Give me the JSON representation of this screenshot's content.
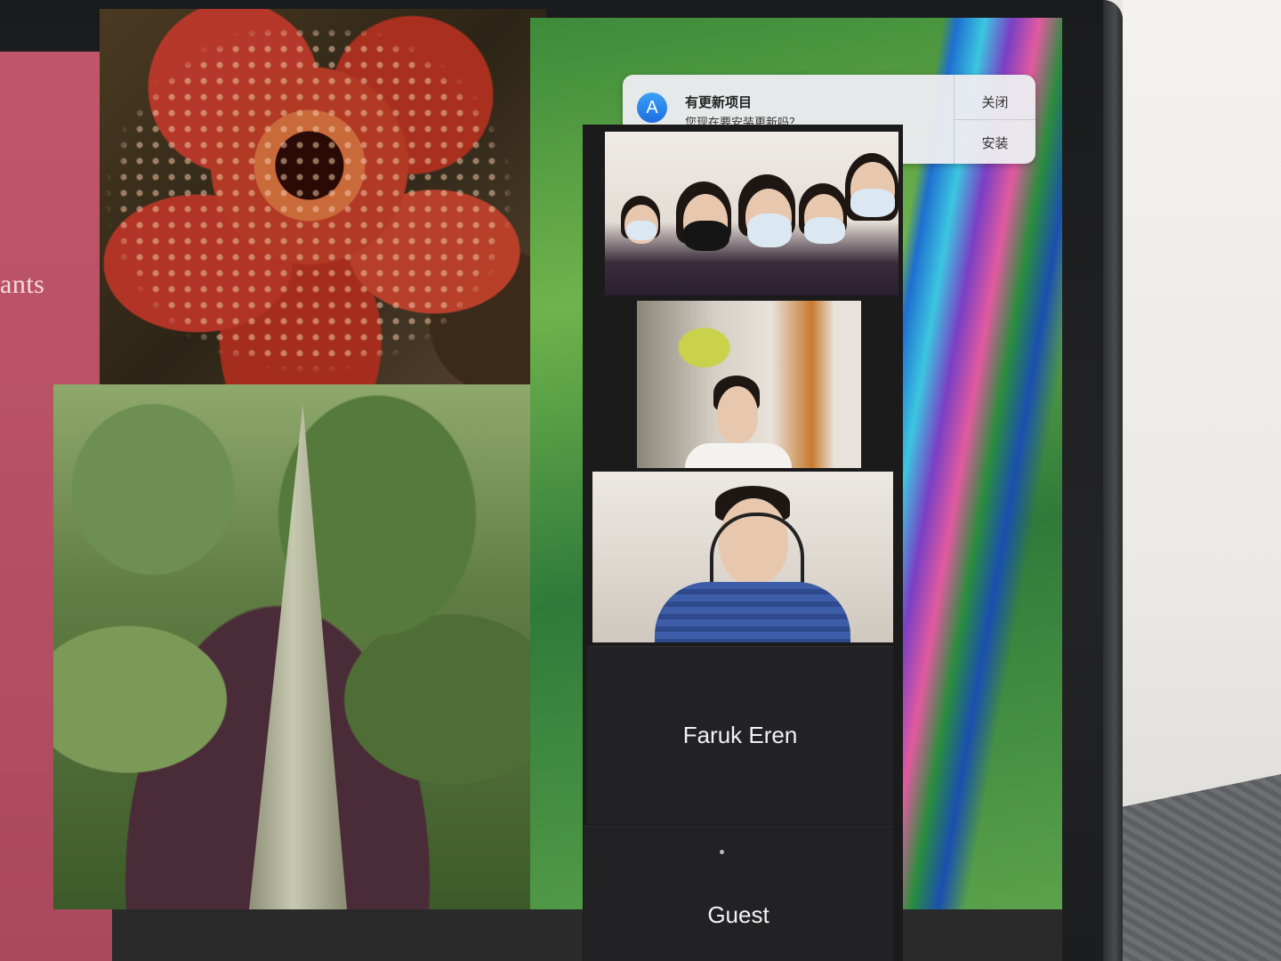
{
  "slide": {
    "side_text": "ants"
  },
  "notification": {
    "title": "有更新项目",
    "subtitle": "您现在要安装更新吗？",
    "icon": "app-store-icon",
    "close_label": "关闭",
    "install_label": "安装"
  },
  "participants": [
    {
      "kind": "video",
      "desc_name": "students-group"
    },
    {
      "kind": "video",
      "desc_name": "student-boy"
    },
    {
      "kind": "video",
      "desc_name": "teacher"
    },
    {
      "kind": "name",
      "label": "Faruk Eren"
    },
    {
      "kind": "name",
      "label": "Guest"
    }
  ],
  "colors": {
    "slide_accent": "#c0566a",
    "gallery_bg": "#1b1b1c",
    "notification_bg": "#ececf0"
  }
}
